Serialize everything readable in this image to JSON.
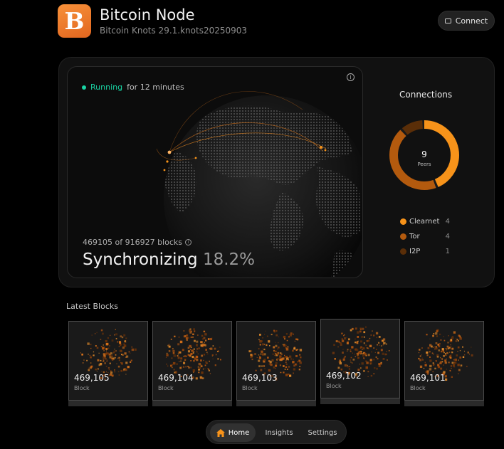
{
  "header": {
    "title": "Bitcoin Node",
    "subtitle": "Bitcoin Knots 29.1.knots20250903",
    "connect_label": "Connect"
  },
  "status": {
    "running_label": "Running",
    "duration": "for 12 minutes",
    "info_glyph": "i"
  },
  "sync": {
    "blocks_text": "469105 of 916927 blocks",
    "label": "Synchronizing",
    "percent": "18.2%",
    "progress": 0.182
  },
  "connections": {
    "title": "Connections",
    "peers_count": "9",
    "peers_label": "Peers",
    "items": [
      {
        "name": "Clearnet",
        "count": "4",
        "color": "#f7931a"
      },
      {
        "name": "Tor",
        "count": "4",
        "color": "#b35a0e"
      },
      {
        "name": "I2P",
        "count": "1",
        "color": "#5a2e08"
      }
    ]
  },
  "latest_blocks": {
    "title": "Latest Blocks",
    "items": [
      {
        "height": "469,105",
        "label": "Block"
      },
      {
        "height": "469,104",
        "label": "Block"
      },
      {
        "height": "469,103",
        "label": "Block"
      },
      {
        "height": "469,102",
        "label": "Block"
      },
      {
        "height": "469,101",
        "label": "Block"
      }
    ]
  },
  "nav": {
    "tabs": [
      {
        "label": "Home",
        "active": true
      },
      {
        "label": "Insights",
        "active": false
      },
      {
        "label": "Settings",
        "active": false
      }
    ]
  },
  "colors": {
    "accent": "#f7931a",
    "running": "#19d4a4"
  }
}
